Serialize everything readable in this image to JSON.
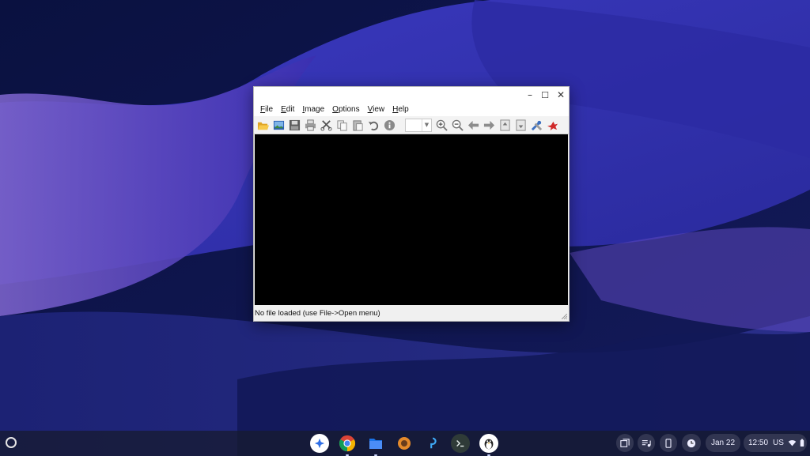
{
  "window": {
    "controls": {
      "minimize": "–",
      "maximize": "☐",
      "close": "✕"
    },
    "menu": [
      {
        "first": "F",
        "rest": "ile"
      },
      {
        "first": "E",
        "rest": "dit"
      },
      {
        "first": "I",
        "rest": "mage"
      },
      {
        "first": "O",
        "rest": "ptions"
      },
      {
        "first": "V",
        "rest": "iew"
      },
      {
        "first": "H",
        "rest": "elp"
      }
    ],
    "toolbar_icons": [
      "open-folder-icon",
      "image-icon",
      "save-icon",
      "print-icon",
      "cut-icon",
      "copy-icon",
      "paste-icon",
      "undo-icon",
      "info-icon",
      "zoom-in-icon",
      "zoom-out-icon",
      "back-arrow-icon",
      "forward-arrow-icon",
      "page-up-icon",
      "page-down-icon",
      "settings-tools-icon",
      "exit-bird-icon"
    ],
    "zoom_select": {
      "value": ""
    },
    "status": "No file loaded (use File->Open menu)"
  },
  "shelf": {
    "apps": [
      "assistant-icon",
      "chrome-icon",
      "files-icon",
      "app-icon",
      "pen-icon",
      "terminal-icon",
      "linux-penguin-icon"
    ],
    "tray": {
      "date": "Jan 22",
      "time": "12:50",
      "locale": "US"
    }
  },
  "colors": {
    "accent_blue": "#2e6fe6",
    "wallpaper_dark": "#0d1442",
    "wallpaper_purple": "#6b4fc6"
  }
}
